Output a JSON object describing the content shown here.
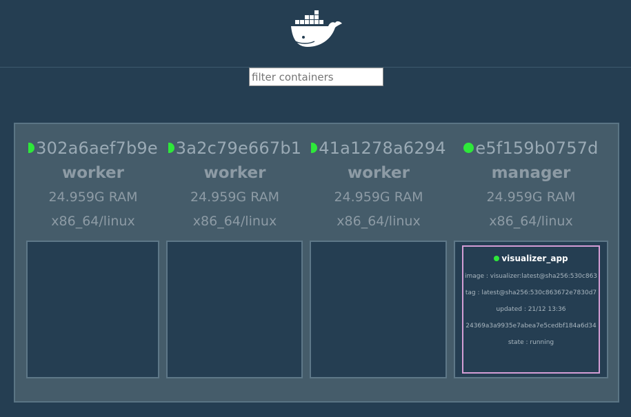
{
  "header": {
    "logo_icon": "docker-whale-icon"
  },
  "filter": {
    "placeholder": "filter containers",
    "value": ""
  },
  "nodes": [
    {
      "id": "302a6aef7b9e",
      "role": "worker",
      "ram": "24.959G RAM",
      "platform": "x86_64/linux",
      "status_color": "#2ee83a",
      "containers": []
    },
    {
      "id": "3a2c79e667b1",
      "role": "worker",
      "ram": "24.959G RAM",
      "platform": "x86_64/linux",
      "status_color": "#2ee83a",
      "containers": []
    },
    {
      "id": "41a1278a6294",
      "role": "worker",
      "ram": "24.959G RAM",
      "platform": "x86_64/linux",
      "status_color": "#2ee83a",
      "containers": []
    },
    {
      "id": "e5f159b0757d",
      "role": "manager",
      "ram": "24.959G RAM",
      "platform": "x86_64/linux",
      "status_color": "#2ee83a",
      "containers": [
        {
          "name": "visualizer_app",
          "image": "image : visualizer:latest@sha256:530c863",
          "tag": "tag : latest@sha256:530c863672e7830d7",
          "updated": "updated : 21/12 13:36",
          "id": "24369a3a9935e7abea7e5cedbf184a6d34",
          "state": "state : running",
          "border_color": "#d59ed6"
        }
      ]
    }
  ]
}
